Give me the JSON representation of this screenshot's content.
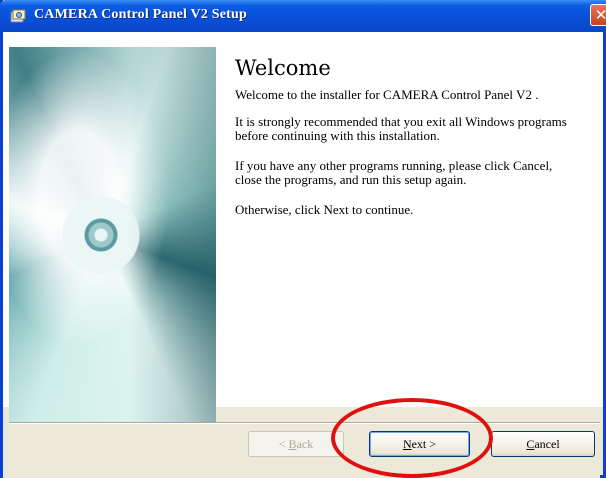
{
  "window": {
    "title": "CAMERA Control Panel V2 Setup",
    "close_glyph": "✕"
  },
  "content": {
    "heading": "Welcome",
    "subtitle": "Welcome to the installer for CAMERA Control Panel V2 .",
    "paragraphs": [
      "It is strongly recommended that you exit all Windows programs\nbefore continuing with this installation.",
      "If you have any other programs running, please click Cancel,\nclose the programs, and run this setup again.",
      "Otherwise, click Next to continue."
    ]
  },
  "buttons": {
    "back": {
      "prefix": "< ",
      "mnemonic": "B",
      "rest": "ack"
    },
    "next": {
      "mnemonic": "N",
      "rest": "ext >"
    },
    "cancel": {
      "mnemonic": "C",
      "rest": "ancel"
    }
  },
  "colors": {
    "titlebar": "#0a4fd6",
    "highlight_circle": "#e01010"
  },
  "icons": {
    "app": "installer-app-icon",
    "close": "close-icon",
    "banner": "cd-disc-image"
  }
}
